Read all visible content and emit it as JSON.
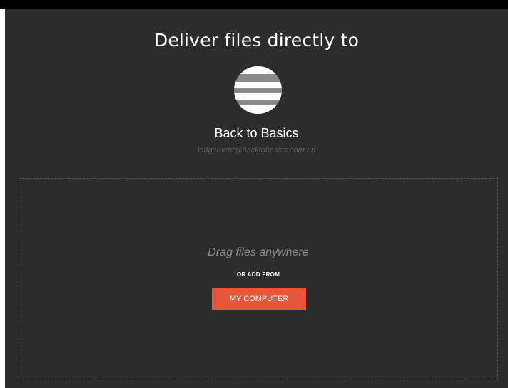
{
  "header": {
    "title": "Deliver files directly to"
  },
  "recipient": {
    "avatar_icon": "stripes-logo-icon",
    "name": "Back to Basics",
    "email": "lodgement@backtobasics.com.au"
  },
  "dropzone": {
    "drag_text": "Drag files anywhere",
    "or_text": "OR ADD FROM",
    "button_label": "MY COMPUTER"
  },
  "colors": {
    "background": "#2c2c2c",
    "accent": "#e8563a",
    "top_bar": "#000000"
  }
}
